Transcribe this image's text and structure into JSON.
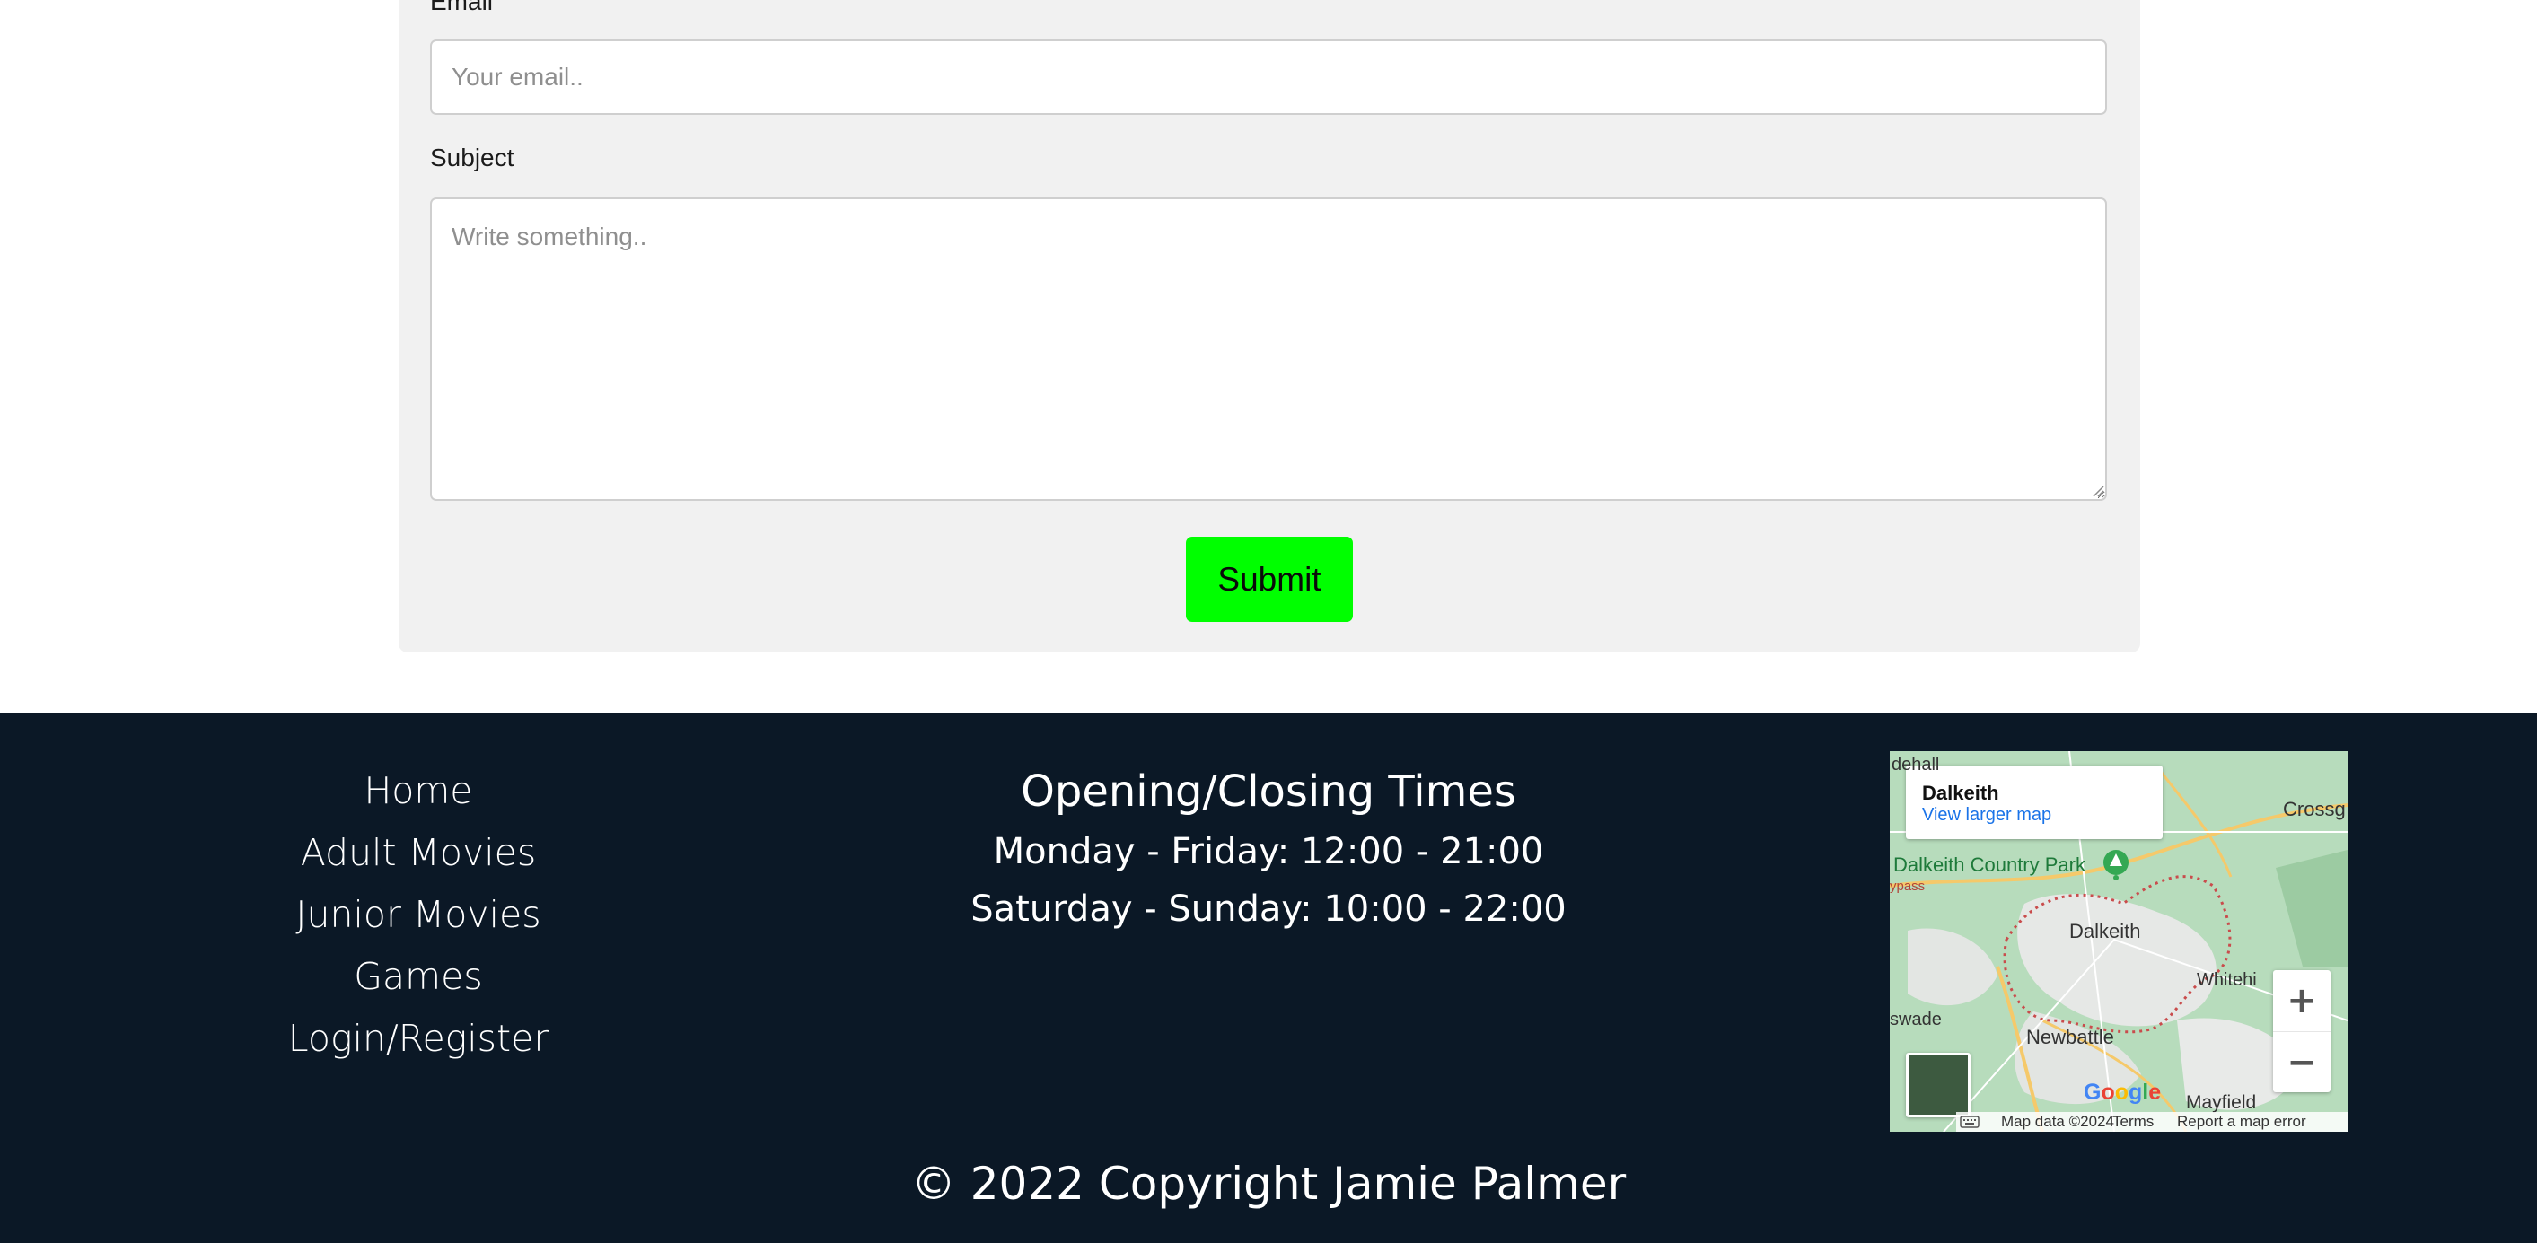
{
  "form": {
    "email_label": "Email",
    "email_placeholder": "Your email..",
    "subject_label": "Subject",
    "subject_placeholder": "Write something..",
    "submit_label": "Submit"
  },
  "footer": {
    "nav": [
      "Home",
      "Adult Movies",
      "Junior Movies",
      "Games",
      "Login/Register"
    ],
    "hours_title": "Opening/Closing Times",
    "hours": [
      "Monday - Friday: 12:00 - 21:00",
      "Saturday - Sunday: 10:00 - 22:00"
    ],
    "copyright": "© 2022 Copyright Jamie Palmer"
  },
  "map": {
    "place": "Dalkeith",
    "view_larger": "View larger map",
    "labels": {
      "dalkeith_country_park": "Dalkeith Country Park",
      "dalkeith": "Dalkeith",
      "newbattle": "Newbattle",
      "mayfield": "Mayfield",
      "crossg": "Crossg",
      "whitehi": "Whitehi",
      "swade": "swade",
      "edge_top": "dehall",
      "bypass": "ypass"
    },
    "google": "Google",
    "attribution": {
      "data": "Map data ©2024",
      "terms": "Terms",
      "report": "Report a map error"
    },
    "zoom_in": "+",
    "zoom_out": "−"
  },
  "colors": {
    "footer_bg": "#0b1826",
    "submit_bg": "#00ff00",
    "card_bg": "#f1f1f1",
    "link": "#1a73e8"
  }
}
